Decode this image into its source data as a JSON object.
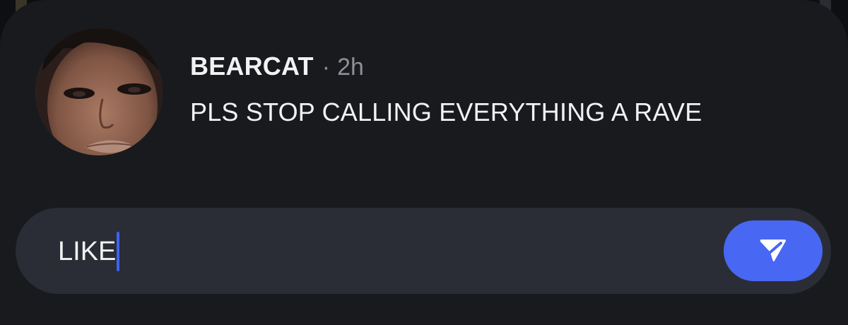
{
  "post": {
    "username": "BEARCAT",
    "separator": "·",
    "timestamp": "2h",
    "text": "PLS STOP CALLING EVERYTHING A RAVE"
  },
  "reply": {
    "value": "LIKE"
  },
  "icons": {
    "send": "send-icon"
  },
  "colors": {
    "accent": "#4867f2",
    "sheet": "#181a1e",
    "input": "#2a2d35"
  }
}
